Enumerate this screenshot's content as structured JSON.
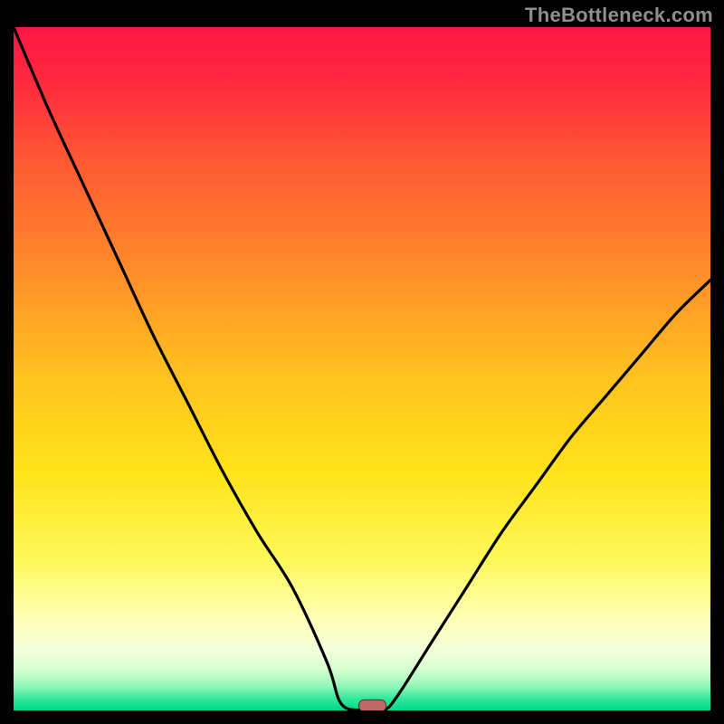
{
  "watermark": "TheBottleneck.com",
  "chart_data": {
    "type": "line",
    "title": "",
    "xlabel": "",
    "ylabel": "",
    "xlim": [
      0,
      100
    ],
    "ylim": [
      0,
      100
    ],
    "series": [
      {
        "name": "curve",
        "x": [
          0,
          5,
          10,
          15,
          20,
          25,
          30,
          35,
          40,
          45,
          47,
          50,
          53,
          55,
          60,
          65,
          70,
          75,
          80,
          85,
          90,
          95,
          100
        ],
        "y": [
          100,
          88,
          77,
          66,
          55,
          45,
          35,
          26,
          18,
          7,
          1,
          0,
          0,
          2,
          10,
          18,
          26,
          33,
          40,
          46,
          52,
          58,
          63
        ]
      }
    ],
    "optimum_marker": {
      "x": 51.5,
      "y": 0.7
    },
    "gradient_stops": [
      {
        "offset": 0.0,
        "color": "#ff1644"
      },
      {
        "offset": 0.08,
        "color": "#ff2a3e"
      },
      {
        "offset": 0.2,
        "color": "#ff5a33"
      },
      {
        "offset": 0.35,
        "color": "#ff8a2a"
      },
      {
        "offset": 0.5,
        "color": "#ffbf1f"
      },
      {
        "offset": 0.65,
        "color": "#ffe31a"
      },
      {
        "offset": 0.78,
        "color": "#fff85a"
      },
      {
        "offset": 0.86,
        "color": "#ffffb0"
      },
      {
        "offset": 0.91,
        "color": "#f3ffd8"
      },
      {
        "offset": 0.94,
        "color": "#d8ffd0"
      },
      {
        "offset": 0.965,
        "color": "#90f7b8"
      },
      {
        "offset": 0.983,
        "color": "#30e89a"
      },
      {
        "offset": 1.0,
        "color": "#00d98a"
      }
    ],
    "colors": {
      "curve": "#000000",
      "marker_fill": "#c06868",
      "marker_stroke": "#5a2a2a",
      "background_frame": "#000000"
    }
  }
}
